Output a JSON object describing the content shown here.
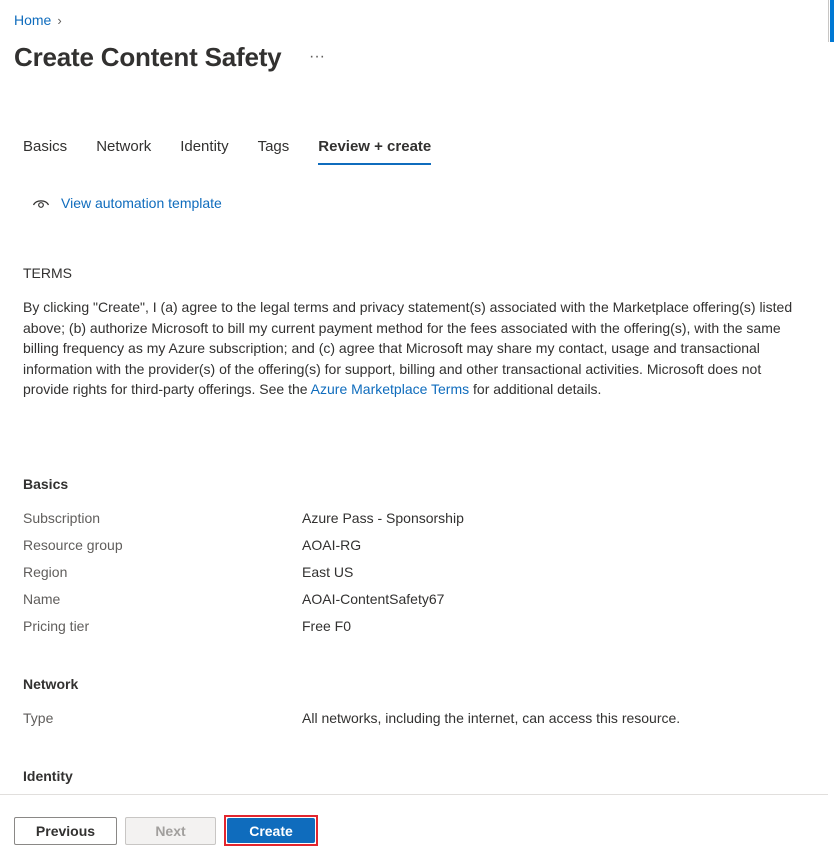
{
  "breadcrumb": {
    "home": "Home",
    "separator": "›"
  },
  "page": {
    "title": "Create Content Safety",
    "more_icon": "ellipsis-icon"
  },
  "tabs": [
    {
      "label": "Basics",
      "active": false
    },
    {
      "label": "Network",
      "active": false
    },
    {
      "label": "Identity",
      "active": false
    },
    {
      "label": "Tags",
      "active": false
    },
    {
      "label": "Review + create",
      "active": true
    }
  ],
  "automation": {
    "icon": "eye-icon",
    "label": "View automation template"
  },
  "terms": {
    "heading": "TERMS",
    "text_before": "By clicking \"Create\", I (a) agree to the legal terms and privacy statement(s) associated with the Marketplace offering(s) listed above; (b) authorize Microsoft to bill my current payment method for the fees associated with the offering(s), with the same billing frequency as my Azure subscription; and (c) agree that Microsoft may share my contact, usage and transactional information with the provider(s) of the offering(s) for support, billing and other transactional activities. Microsoft does not provide rights for third-party offerings. See the ",
    "link": "Azure Marketplace Terms",
    "text_after": " for additional details."
  },
  "basics": {
    "title": "Basics",
    "rows": [
      {
        "key": "Subscription",
        "value": "Azure Pass - Sponsorship"
      },
      {
        "key": "Resource group",
        "value": "AOAI-RG"
      },
      {
        "key": "Region",
        "value": "East US"
      },
      {
        "key": "Name",
        "value": "AOAI-ContentSafety67"
      },
      {
        "key": "Pricing tier",
        "value": "Free F0"
      }
    ]
  },
  "network": {
    "title": "Network",
    "rows": [
      {
        "key": "Type",
        "value": "All networks, including the internet, can access this resource."
      }
    ]
  },
  "identity": {
    "title": "Identity"
  },
  "footer": {
    "previous": "Previous",
    "next": "Next",
    "create": "Create"
  },
  "colors": {
    "accent": "#0f6cbd",
    "highlight_outline": "#e3262e"
  }
}
